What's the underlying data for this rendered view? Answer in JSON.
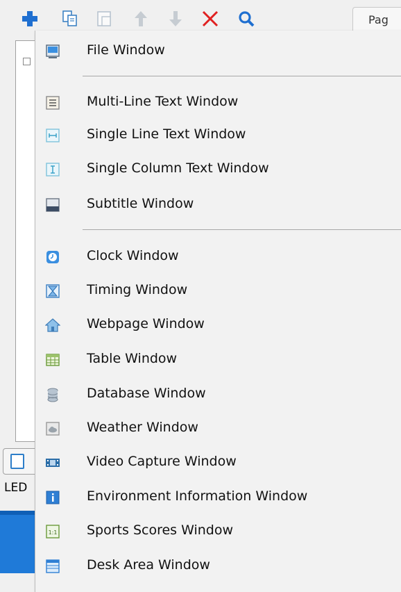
{
  "toolbar": {
    "tab_label": "Pag",
    "icons": [
      "add-icon",
      "copy-icon",
      "paste-icon",
      "move-up-icon",
      "move-down-icon",
      "delete-icon",
      "search-icon"
    ]
  },
  "left_panel": {
    "led_label": "LED"
  },
  "menu": {
    "items": [
      {
        "label": "File Window",
        "icon": "file-window-icon"
      },
      {
        "label": "Multi-Line Text Window",
        "icon": "multi-line-text-icon"
      },
      {
        "label": "Single Line Text Window",
        "icon": "single-line-text-icon"
      },
      {
        "label": "Single Column Text Window",
        "icon": "single-column-text-icon"
      },
      {
        "label": "Subtitle Window",
        "icon": "subtitle-icon"
      },
      {
        "label": "Clock Window",
        "icon": "clock-icon"
      },
      {
        "label": "Timing Window",
        "icon": "hourglass-icon"
      },
      {
        "label": "Webpage Window",
        "icon": "home-icon"
      },
      {
        "label": "Table Window",
        "icon": "table-icon"
      },
      {
        "label": "Database Window",
        "icon": "database-icon"
      },
      {
        "label": "Weather Window",
        "icon": "cloud-icon"
      },
      {
        "label": "Video Capture Window",
        "icon": "film-icon"
      },
      {
        "label": "Environment Information Window",
        "icon": "info-icon"
      },
      {
        "label": "Sports Scores Window",
        "icon": "score-icon"
      },
      {
        "label": "Desk Area Window",
        "icon": "desk-area-icon"
      }
    ]
  },
  "colors": {
    "accent_blue": "#1f7ad8",
    "delete_red": "#e02020",
    "menu_background": "#f2f2f2"
  }
}
